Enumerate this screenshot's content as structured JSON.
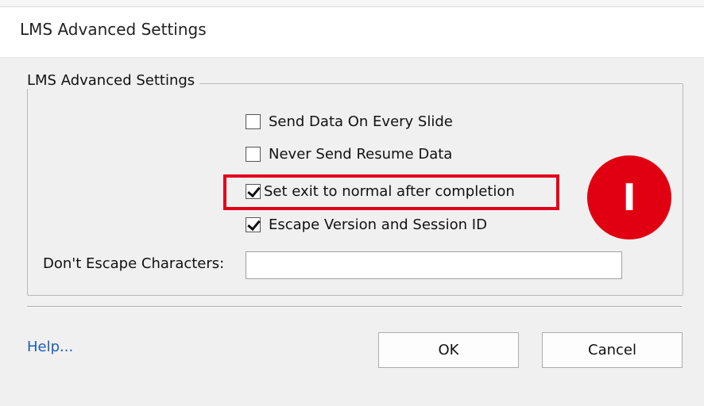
{
  "window": {
    "title": "LMS Advanced Settings"
  },
  "group": {
    "legend": "LMS Advanced Settings",
    "checkboxes": [
      {
        "label": "Send Data On Every Slide",
        "checked": false
      },
      {
        "label": "Never Send Resume Data",
        "checked": false
      },
      {
        "label": "Set exit to normal after completion",
        "checked": true
      },
      {
        "label": "Escape Version and Session ID",
        "checked": true
      }
    ],
    "dont_escape": {
      "label": "Don't Escape Characters:",
      "value": "",
      "placeholder": ""
    }
  },
  "annotation": {
    "marker_text": "I",
    "marker_color": "#e00012",
    "highlight_color": "#e3001b"
  },
  "footer": {
    "help_label": "Help...",
    "ok_label": "OK",
    "cancel_label": "Cancel"
  }
}
